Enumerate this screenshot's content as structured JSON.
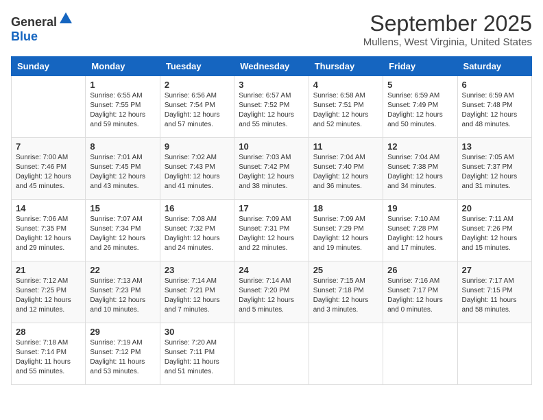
{
  "header": {
    "logo_general": "General",
    "logo_blue": "Blue",
    "month_title": "September 2025",
    "location": "Mullens, West Virginia, United States"
  },
  "weekdays": [
    "Sunday",
    "Monday",
    "Tuesday",
    "Wednesday",
    "Thursday",
    "Friday",
    "Saturday"
  ],
  "weeks": [
    [
      {
        "day": "",
        "info": ""
      },
      {
        "day": "1",
        "info": "Sunrise: 6:55 AM\nSunset: 7:55 PM\nDaylight: 12 hours\nand 59 minutes."
      },
      {
        "day": "2",
        "info": "Sunrise: 6:56 AM\nSunset: 7:54 PM\nDaylight: 12 hours\nand 57 minutes."
      },
      {
        "day": "3",
        "info": "Sunrise: 6:57 AM\nSunset: 7:52 PM\nDaylight: 12 hours\nand 55 minutes."
      },
      {
        "day": "4",
        "info": "Sunrise: 6:58 AM\nSunset: 7:51 PM\nDaylight: 12 hours\nand 52 minutes."
      },
      {
        "day": "5",
        "info": "Sunrise: 6:59 AM\nSunset: 7:49 PM\nDaylight: 12 hours\nand 50 minutes."
      },
      {
        "day": "6",
        "info": "Sunrise: 6:59 AM\nSunset: 7:48 PM\nDaylight: 12 hours\nand 48 minutes."
      }
    ],
    [
      {
        "day": "7",
        "info": "Sunrise: 7:00 AM\nSunset: 7:46 PM\nDaylight: 12 hours\nand 45 minutes."
      },
      {
        "day": "8",
        "info": "Sunrise: 7:01 AM\nSunset: 7:45 PM\nDaylight: 12 hours\nand 43 minutes."
      },
      {
        "day": "9",
        "info": "Sunrise: 7:02 AM\nSunset: 7:43 PM\nDaylight: 12 hours\nand 41 minutes."
      },
      {
        "day": "10",
        "info": "Sunrise: 7:03 AM\nSunset: 7:42 PM\nDaylight: 12 hours\nand 38 minutes."
      },
      {
        "day": "11",
        "info": "Sunrise: 7:04 AM\nSunset: 7:40 PM\nDaylight: 12 hours\nand 36 minutes."
      },
      {
        "day": "12",
        "info": "Sunrise: 7:04 AM\nSunset: 7:38 PM\nDaylight: 12 hours\nand 34 minutes."
      },
      {
        "day": "13",
        "info": "Sunrise: 7:05 AM\nSunset: 7:37 PM\nDaylight: 12 hours\nand 31 minutes."
      }
    ],
    [
      {
        "day": "14",
        "info": "Sunrise: 7:06 AM\nSunset: 7:35 PM\nDaylight: 12 hours\nand 29 minutes."
      },
      {
        "day": "15",
        "info": "Sunrise: 7:07 AM\nSunset: 7:34 PM\nDaylight: 12 hours\nand 26 minutes."
      },
      {
        "day": "16",
        "info": "Sunrise: 7:08 AM\nSunset: 7:32 PM\nDaylight: 12 hours\nand 24 minutes."
      },
      {
        "day": "17",
        "info": "Sunrise: 7:09 AM\nSunset: 7:31 PM\nDaylight: 12 hours\nand 22 minutes."
      },
      {
        "day": "18",
        "info": "Sunrise: 7:09 AM\nSunset: 7:29 PM\nDaylight: 12 hours\nand 19 minutes."
      },
      {
        "day": "19",
        "info": "Sunrise: 7:10 AM\nSunset: 7:28 PM\nDaylight: 12 hours\nand 17 minutes."
      },
      {
        "day": "20",
        "info": "Sunrise: 7:11 AM\nSunset: 7:26 PM\nDaylight: 12 hours\nand 15 minutes."
      }
    ],
    [
      {
        "day": "21",
        "info": "Sunrise: 7:12 AM\nSunset: 7:25 PM\nDaylight: 12 hours\nand 12 minutes."
      },
      {
        "day": "22",
        "info": "Sunrise: 7:13 AM\nSunset: 7:23 PM\nDaylight: 12 hours\nand 10 minutes."
      },
      {
        "day": "23",
        "info": "Sunrise: 7:14 AM\nSunset: 7:21 PM\nDaylight: 12 hours\nand 7 minutes."
      },
      {
        "day": "24",
        "info": "Sunrise: 7:14 AM\nSunset: 7:20 PM\nDaylight: 12 hours\nand 5 minutes."
      },
      {
        "day": "25",
        "info": "Sunrise: 7:15 AM\nSunset: 7:18 PM\nDaylight: 12 hours\nand 3 minutes."
      },
      {
        "day": "26",
        "info": "Sunrise: 7:16 AM\nSunset: 7:17 PM\nDaylight: 12 hours\nand 0 minutes."
      },
      {
        "day": "27",
        "info": "Sunrise: 7:17 AM\nSunset: 7:15 PM\nDaylight: 11 hours\nand 58 minutes."
      }
    ],
    [
      {
        "day": "28",
        "info": "Sunrise: 7:18 AM\nSunset: 7:14 PM\nDaylight: 11 hours\nand 55 minutes."
      },
      {
        "day": "29",
        "info": "Sunrise: 7:19 AM\nSunset: 7:12 PM\nDaylight: 11 hours\nand 53 minutes."
      },
      {
        "day": "30",
        "info": "Sunrise: 7:20 AM\nSunset: 7:11 PM\nDaylight: 11 hours\nand 51 minutes."
      },
      {
        "day": "",
        "info": ""
      },
      {
        "day": "",
        "info": ""
      },
      {
        "day": "",
        "info": ""
      },
      {
        "day": "",
        "info": ""
      }
    ]
  ]
}
